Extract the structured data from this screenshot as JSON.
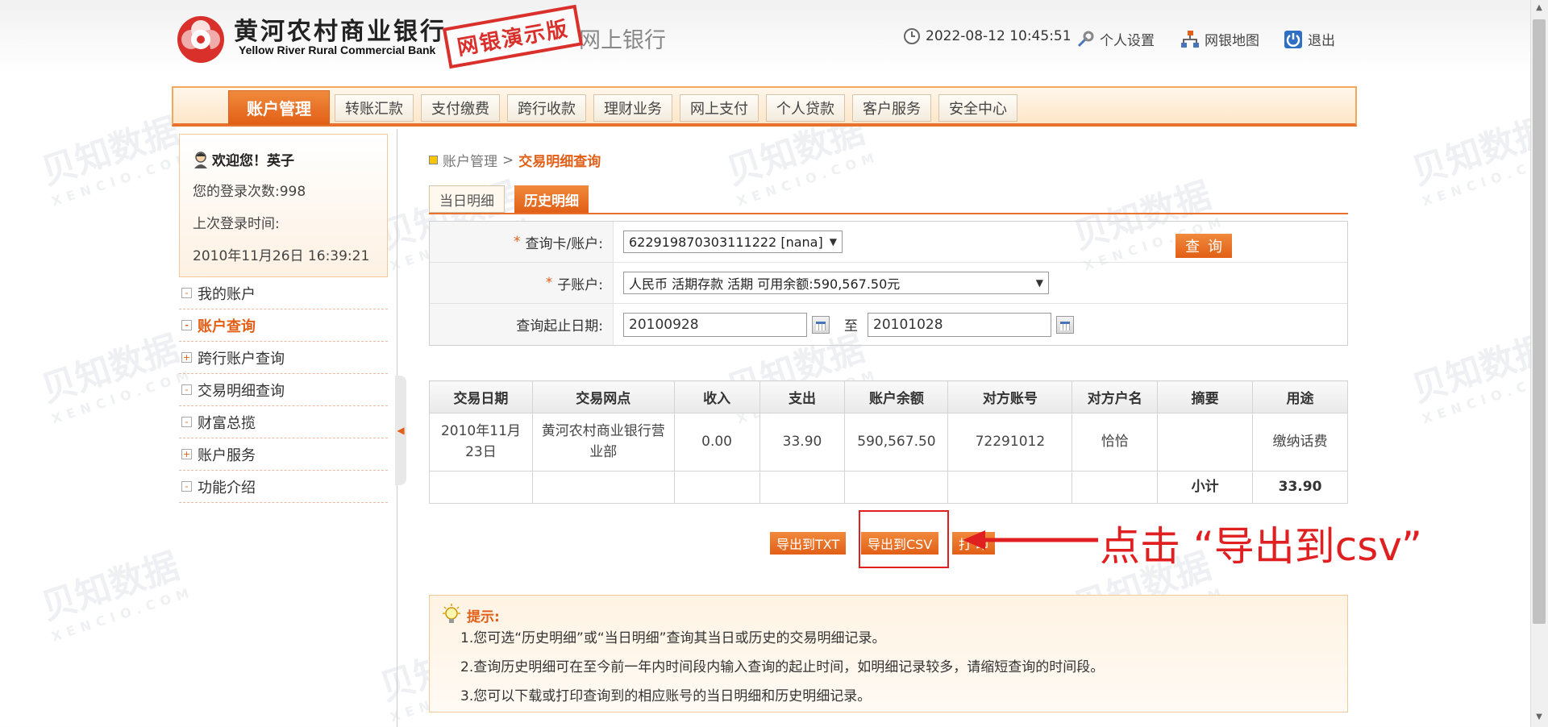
{
  "header": {
    "logo_cn": "黄河农村商业银行",
    "logo_en": "Yellow River Rural Commercial Bank",
    "demo_stamp": "网银演示版",
    "brand_tail": "网上银行",
    "datetime": "2022-08-12 10:45:51",
    "links": [
      {
        "label": "个人设置",
        "icon": "settings-icon"
      },
      {
        "label": "网银地图",
        "icon": "sitemap-icon"
      },
      {
        "label": "退出",
        "icon": "power-icon"
      }
    ]
  },
  "nav": {
    "items": [
      "账户管理",
      "转账汇款",
      "支付缴费",
      "跨行收款",
      "理财业务",
      "网上支付",
      "个人贷款",
      "客户服务",
      "安全中心"
    ],
    "active_index": 0
  },
  "welcome": {
    "greeting": "欢迎您！英子",
    "login_count": "您的登录次数:998",
    "last_login_label": "上次登录时间:",
    "last_login_time": "2010年11月26日 16:39:21"
  },
  "side_menu": [
    {
      "symbol": "-",
      "label": "我的账户"
    },
    {
      "symbol": "-",
      "label": "账户查询",
      "active": true
    },
    {
      "symbol": "+",
      "label": "跨行账户查询"
    },
    {
      "symbol": "-",
      "label": "交易明细查询"
    },
    {
      "symbol": "-",
      "label": "财富总揽"
    },
    {
      "symbol": "+",
      "label": "账户服务"
    },
    {
      "symbol": "-",
      "label": "功能介绍"
    }
  ],
  "breadcrumb": {
    "parent": "账户管理",
    "separator": ">",
    "current": "交易明细查询"
  },
  "tabs": {
    "today": "当日明细",
    "history": "历史明细"
  },
  "form": {
    "card_label": "查询卡/账户:",
    "card_value": "622919870303111222 [nana]",
    "sub_label": "子账户:",
    "sub_value": "人民币 活期存款 活期 可用余额:590,567.50元",
    "date_label": "查询起止日期:",
    "date_from": "20100928",
    "date_sep": "至",
    "date_to": "20101028",
    "query_button": "查询"
  },
  "table": {
    "headers": [
      "交易日期",
      "交易网点",
      "收入",
      "支出",
      "账户余额",
      "对方账号",
      "对方户名",
      "摘要",
      "用途"
    ],
    "rows": [
      [
        "2010年11月23日",
        "黄河农村商业银行营业部",
        "0.00",
        "33.90",
        "590,567.50",
        "72291012",
        "恰恰",
        "",
        "缴纳话费"
      ]
    ],
    "subtotal_label": "小计",
    "subtotal_value": "33.90"
  },
  "actions": {
    "export_txt": "导出到TXT",
    "export_csv": "导出到CSV",
    "print": "打 印"
  },
  "callout": "点击 “导出到csv”",
  "tips": {
    "title": "提示:",
    "lines": [
      "1.您可选“历史明细”或“当日明细”查询其当日或历史的交易明细记录。",
      "2.查询历史明细可在至今前一年内时间段内输入查询的起止时间，如明细记录较多，请缩短查询的时间段。",
      "3.您可以下载或打印查询到的相应账号的当日明细和历史明细记录。"
    ]
  },
  "watermark": {
    "cn": "贝知数据",
    "en": "XENCIO.COM"
  },
  "colors": {
    "accent": "#e25f17",
    "callout": "#e02020",
    "nav_border": "#f2a85b"
  }
}
